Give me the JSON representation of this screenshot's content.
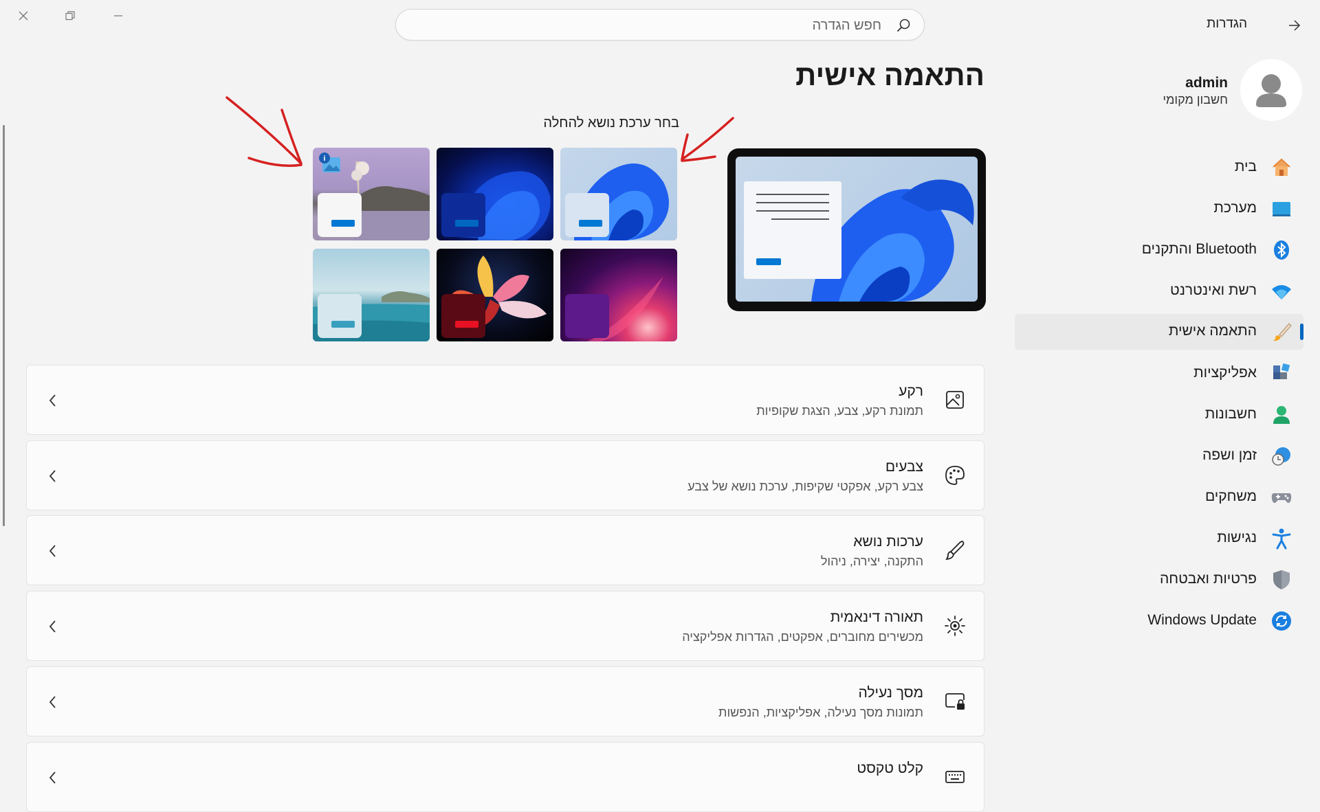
{
  "app": {
    "title": "הגדרות"
  },
  "search": {
    "placeholder": "חפש הגדרה"
  },
  "profile": {
    "name": "admin",
    "account_type": "חשבון מקומי"
  },
  "sidebar": {
    "items": [
      {
        "label": "בית",
        "icon": "home-icon"
      },
      {
        "label": "מערכת",
        "icon": "system-icon"
      },
      {
        "label": "Bluetooth והתקנים",
        "icon": "bluetooth-icon"
      },
      {
        "label": "רשת ואינטרנט",
        "icon": "wifi-icon"
      },
      {
        "label": "התאמה אישית",
        "icon": "brush-icon",
        "active": true
      },
      {
        "label": "אפליקציות",
        "icon": "apps-icon"
      },
      {
        "label": "חשבונות",
        "icon": "person-icon"
      },
      {
        "label": "זמן ושפה",
        "icon": "globe-clock-icon"
      },
      {
        "label": "משחקים",
        "icon": "gamepad-icon"
      },
      {
        "label": "נגישות",
        "icon": "accessibility-icon"
      },
      {
        "label": "פרטיות ואבטחה",
        "icon": "shield-icon"
      },
      {
        "label": "Windows Update",
        "icon": "update-icon"
      }
    ]
  },
  "main": {
    "title": "התאמה אישית",
    "theme_caption": "בחר ערכת נושא להחלה",
    "themes": [
      {
        "name": "light-bloom",
        "accent": "#0078d4"
      },
      {
        "name": "dark-bloom",
        "accent": "#0067c0"
      },
      {
        "name": "lake-landscape",
        "accent": "#0078d4"
      },
      {
        "name": "purple-glow",
        "accent": "#5c1a8a"
      },
      {
        "name": "dark-flower",
        "accent": "#e81123"
      },
      {
        "name": "coastal",
        "accent": "#3a9fbf"
      }
    ],
    "cards": [
      {
        "title": "רקע",
        "subtitle": "תמונת רקע, צבע, הצגת שקופיות",
        "icon": "image-icon"
      },
      {
        "title": "צבעים",
        "subtitle": "צבע רקע, אפקטי שקיפות, ערכת נושא של צבע",
        "icon": "palette-icon"
      },
      {
        "title": "ערכות נושא",
        "subtitle": "התקנה, יצירה, ניהול",
        "icon": "brush-icon"
      },
      {
        "title": "תאורה דינאמית",
        "subtitle": "מכשירים מחוברים, אפקטים, הגדרות אפליקציה",
        "icon": "light-icon"
      },
      {
        "title": "מסך נעילה",
        "subtitle": "תמונות מסך נעילה, אפליקציות, הנפשות",
        "icon": "lock-screen-icon"
      },
      {
        "title": "קלט טקסט",
        "subtitle": "",
        "icon": "keyboard-icon"
      }
    ]
  },
  "colors": {
    "accent": "#0067c0",
    "annotation": "#d62020"
  }
}
